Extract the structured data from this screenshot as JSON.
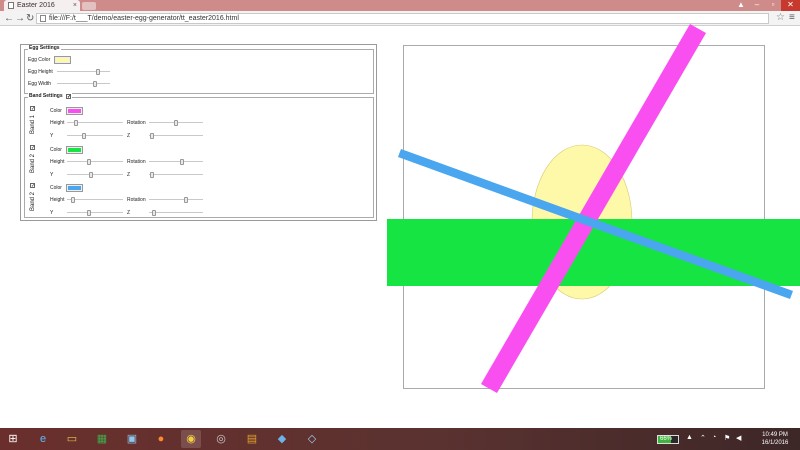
{
  "browser": {
    "tab_title": "Easter 2016",
    "url": "file:///F:/t___T/demo/easter-egg-generator/tt_easter2016.html"
  },
  "egg_settings": {
    "legend": "Egg Settings",
    "color_label": "Egg Color",
    "color": "#fef9a8",
    "height_label": "Egg Height",
    "height_value": 0.78,
    "width_label": "Egg Width",
    "width_value": 0.71
  },
  "band_settings": {
    "legend": "Band Settings",
    "enabled": true,
    "labels": {
      "color": "Color",
      "height": "Height",
      "rotation": "Rotation",
      "y": "Y",
      "z": "Z"
    },
    "bands": [
      {
        "label": "Band 1",
        "enabled": true,
        "color": "#f94ff0",
        "height": 0.16,
        "rotation": 0.5,
        "y": 0.3,
        "z": 0.06
      },
      {
        "label": "Band 2",
        "enabled": true,
        "color": "#15e442",
        "height": 0.4,
        "rotation": 0.62,
        "y": 0.42,
        "z": 0.06
      },
      {
        "label": "Band 2",
        "enabled": true,
        "color": "#4aa6ee",
        "height": 0.1,
        "rotation": 0.68,
        "y": 0.4,
        "z": 0.1
      }
    ]
  },
  "taskbar": {
    "battery": "66%",
    "time": "10:49 PM",
    "date": "16/1/2016"
  }
}
